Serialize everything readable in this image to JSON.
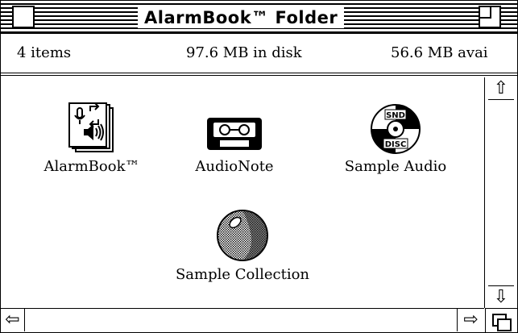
{
  "window": {
    "title": "AlarmBook™ Folder"
  },
  "info_bar": {
    "items": "4 items",
    "in_disk": "97.6 MB in disk",
    "available": "56.6 MB avai"
  },
  "files": [
    {
      "name": "AlarmBook™",
      "icon": "alarmbook-app-icon"
    },
    {
      "name": "AudioNote",
      "icon": "cassette-icon"
    },
    {
      "name": "Sample Audio",
      "icon": "snd-disc-icon"
    },
    {
      "name": "Sample Collection",
      "icon": "sphere-icon"
    }
  ],
  "icons": {
    "snd_top": "SND",
    "snd_bottom": "DISC"
  }
}
